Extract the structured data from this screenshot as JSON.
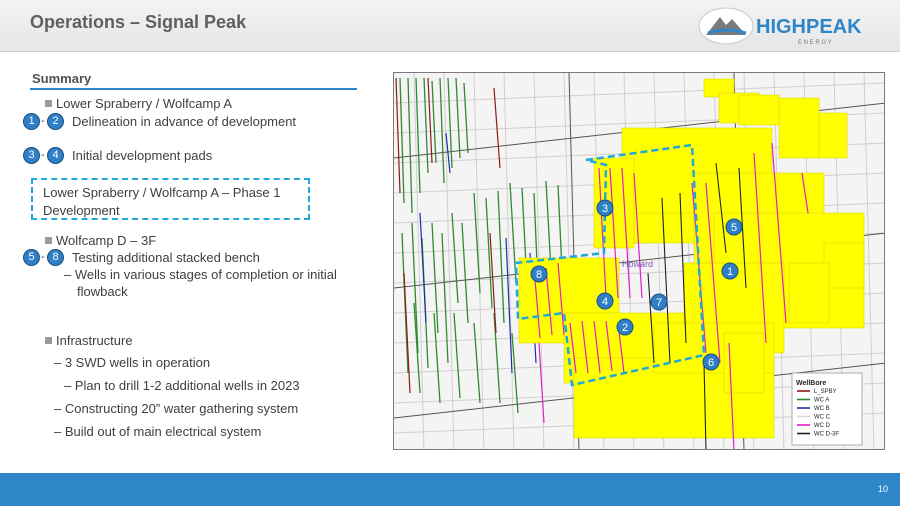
{
  "header": {
    "title": "Operations – Signal Peak",
    "logo_text": "HIGHPEAK",
    "logo_subtext": "E N E R G Y"
  },
  "summary": {
    "heading": "Summary",
    "b1": "Lower Spraberry / Wolfcamp A",
    "b1_badge_a": "1",
    "b1_badge_b": "2",
    "b1_text": "Delineation in advance of development",
    "b2_badge_a": "3",
    "b2_badge_b": "4",
    "b2_text": "Initial development pads",
    "phase_box": "Lower Spraberry / Wolfcamp A – Phase 1 Development",
    "b3": "Wolfcamp D – 3F",
    "b3_badge_a": "5",
    "b3_badge_b": "8",
    "b3_text": "Testing additional stacked bench",
    "b3_sub_line1": "– Wells in various stages of completion or initial",
    "b3_sub_line2": "flowback",
    "b4": "Infrastructure",
    "b4_sub1": "– 3 SWD wells in operation",
    "b4_sub1a": "– Plan to drill 1-2 additional wells in 2023",
    "b4_sub2": "– Constructing 20” water gathering system",
    "b4_sub3": "– Build out of main electrical system"
  },
  "map": {
    "label_howard": "Howard",
    "markers": [
      "1",
      "2",
      "3",
      "4",
      "5",
      "6",
      "7",
      "8"
    ],
    "legend": {
      "title": "WellBore",
      "items": [
        {
          "label": "L_SPBY",
          "color": "#8b1a1a"
        },
        {
          "label": "WC A",
          "color": "#2e8b2e"
        },
        {
          "label": "WC B",
          "color": "#1f2ea8"
        },
        {
          "label": "WC C",
          "color": "#d8d8d8"
        },
        {
          "label": "WC D",
          "color": "#e020c8"
        },
        {
          "label": "WC D-3F",
          "color": "#222222"
        }
      ]
    },
    "colors": {
      "acreage": "#ffff00",
      "outline": "#1ea9d8",
      "marker": "#2f7fc6"
    }
  },
  "footer": {
    "page_number": "10"
  }
}
